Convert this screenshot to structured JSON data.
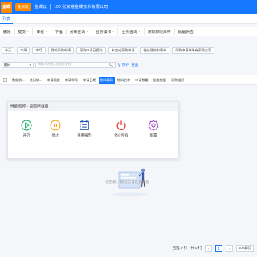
{
  "topbar": {
    "logo_text": "金蝶",
    "trial_badge": "免费版",
    "app_name": "金蝶云",
    "org_name": "100 张家港金蝶技术有限公司"
  },
  "tabs": {
    "active": "列表"
  },
  "toolbar": {
    "items": [
      {
        "label": "删除",
        "has_menu": false
      },
      {
        "label": "提交",
        "has_menu": true
      },
      {
        "label": "审核",
        "has_menu": true
      },
      {
        "label": "下推",
        "has_menu": false
      },
      {
        "label": "关联查询",
        "has_menu": true
      },
      {
        "label": "业务操作",
        "has_menu": true
      },
      {
        "label": "业务查询",
        "has_menu": true
      },
      {
        "label": "获取即时库存",
        "has_menu": false
      },
      {
        "label": "数据供应",
        "has_menu": false
      }
    ]
  },
  "filters": {
    "chips": [
      "今天",
      "本周",
      "本月",
      "我的采购申请",
      "采购申请已提交",
      "未完成采购申请",
      "待处理的申请单",
      "采购申请单所有采购方案"
    ]
  },
  "search": {
    "field_value": "编码",
    "placeholder": "请输入关键字后回车查找",
    "save_label": "保存",
    "reset_label": "重置"
  },
  "table": {
    "columns": [
      "数据状...",
      "关闭状...",
      "申请组织",
      "申请单号",
      "申请日期",
      "物料编码",
      "物料名称",
      "申请数量",
      "批准数量",
      "采购组织"
    ],
    "highlighted_column": 5
  },
  "modal": {
    "title": "性能监控 - 采购申请单",
    "actions": [
      {
        "label": "开启",
        "icon": "play-circle-icon",
        "color": "#23b26d"
      },
      {
        "label": "停止",
        "icon": "pause-circle-icon",
        "color": "#f5a623"
      },
      {
        "label": "查看报告",
        "icon": "report-list-icon",
        "color": "#1f4fb3"
      },
      {
        "label": "停止所有",
        "icon": "power-icon",
        "color": "#e63a3a"
      },
      {
        "label": "配置",
        "icon": "settings-gear-icon",
        "color": "#9b3fc6"
      }
    ]
  },
  "empty_state": {
    "message": "很抱歉，暂时没有任何数据~"
  },
  "footer": {
    "selected_label": "已选 0 行",
    "total_label": "共 0 行",
    "page": "1",
    "page_size": "100条/页"
  },
  "colors": {
    "primary": "#1677ff",
    "accent": "#ff8a00"
  }
}
